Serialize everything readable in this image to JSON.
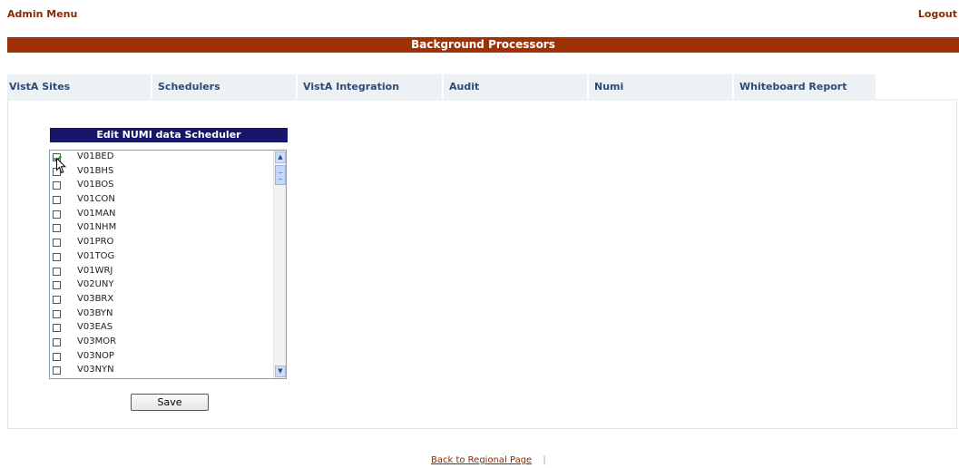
{
  "header": {
    "admin_menu": "Admin Menu",
    "logout": "Logout",
    "title": "Background Processors"
  },
  "tabs": [
    "VistA Sites",
    "Schedulers",
    "VistA Integration",
    "Audit",
    "Numi",
    "Whiteboard Report"
  ],
  "scheduler": {
    "title": "Edit NUMI data Scheduler",
    "items": [
      {
        "label": "V01BED",
        "checked": true
      },
      {
        "label": "V01BHS",
        "checked": false
      },
      {
        "label": "V01BOS",
        "checked": false
      },
      {
        "label": "V01CON",
        "checked": false
      },
      {
        "label": "V01MAN",
        "checked": false
      },
      {
        "label": "V01NHM",
        "checked": false
      },
      {
        "label": "V01PRO",
        "checked": false
      },
      {
        "label": "V01TOG",
        "checked": false
      },
      {
        "label": "V01WRJ",
        "checked": false
      },
      {
        "label": "V02UNY",
        "checked": false
      },
      {
        "label": "V03BRX",
        "checked": false
      },
      {
        "label": "V03BYN",
        "checked": false
      },
      {
        "label": "V03EAS",
        "checked": false
      },
      {
        "label": "V03MOR",
        "checked": false
      },
      {
        "label": "V03NOP",
        "checked": false
      },
      {
        "label": "V03NYN",
        "checked": false
      }
    ],
    "save_label": "Save"
  },
  "footer": {
    "back_link": "Back to Regional Page",
    "separator": "|"
  },
  "colors": {
    "title_bar": "#9e3206",
    "scheduler_header": "#16166a",
    "link": "#8a2a00",
    "tab_text": "#2a4a78"
  },
  "icons": {
    "scroll_up": "scroll-up-arrow-icon",
    "scroll_down": "scroll-down-arrow-icon",
    "cursor": "mouse-pointer-icon"
  }
}
